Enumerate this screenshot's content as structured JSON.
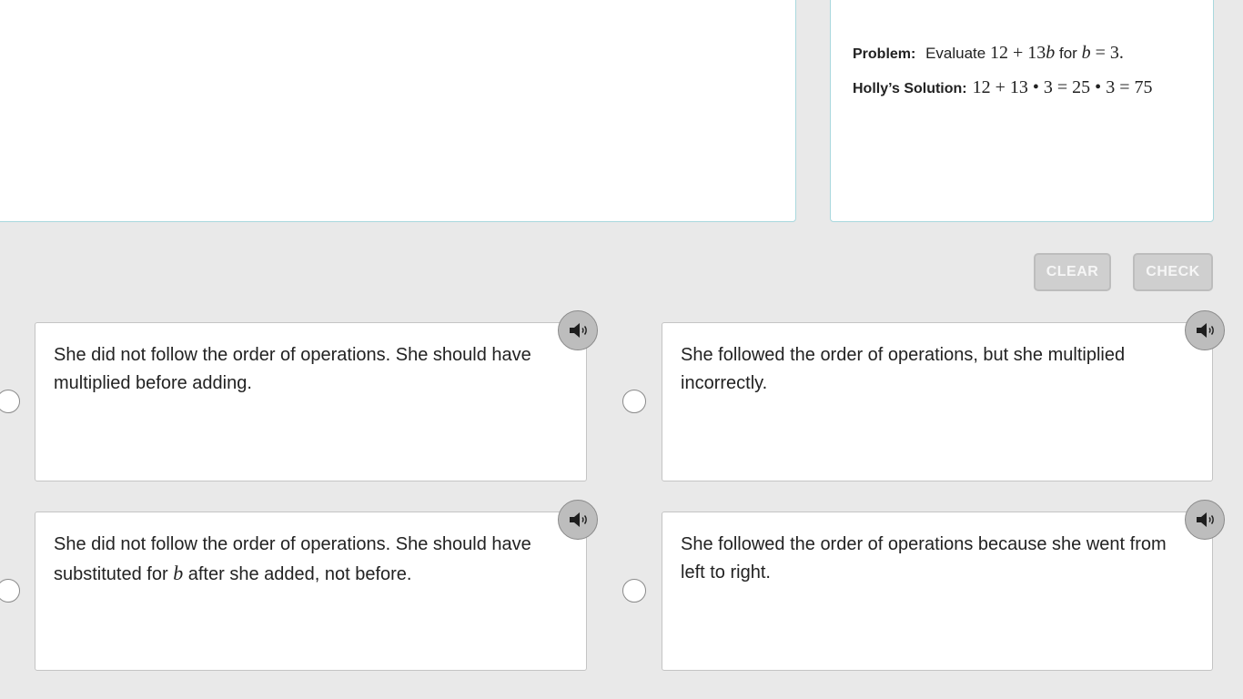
{
  "problem": {
    "label": "Problem:",
    "text_prefix": "Evaluate",
    "expr_num": "12 + 13",
    "expr_var": "b",
    "for_word": "for",
    "var": "b",
    "eq_value": " = 3."
  },
  "solution": {
    "label": "Holly’s Solution:",
    "expr": "12 + 13 • 3 = 25 • 3 = 75"
  },
  "buttons": {
    "clear": "CLEAR",
    "check": "CHECK"
  },
  "choices": [
    {
      "text": "She did not follow the order of operations. She should have multiplied before adding."
    },
    {
      "text": "She followed the order of operations, but she multiplied incorrectly."
    },
    {
      "text_before": "She did not follow the order of operations. She should have substituted for ",
      "var": "b",
      "text_after": " after she added, not before."
    },
    {
      "text": "She followed the order of operations because she went from left to right."
    }
  ],
  "icons": {
    "audio": "speaker-icon",
    "radio": "radio-icon"
  },
  "colors": {
    "background": "#e9e9e9",
    "panel_border": "#a9d8de",
    "button_disabled": "#cfcfcf",
    "audio_button": "#bdbdbd"
  }
}
